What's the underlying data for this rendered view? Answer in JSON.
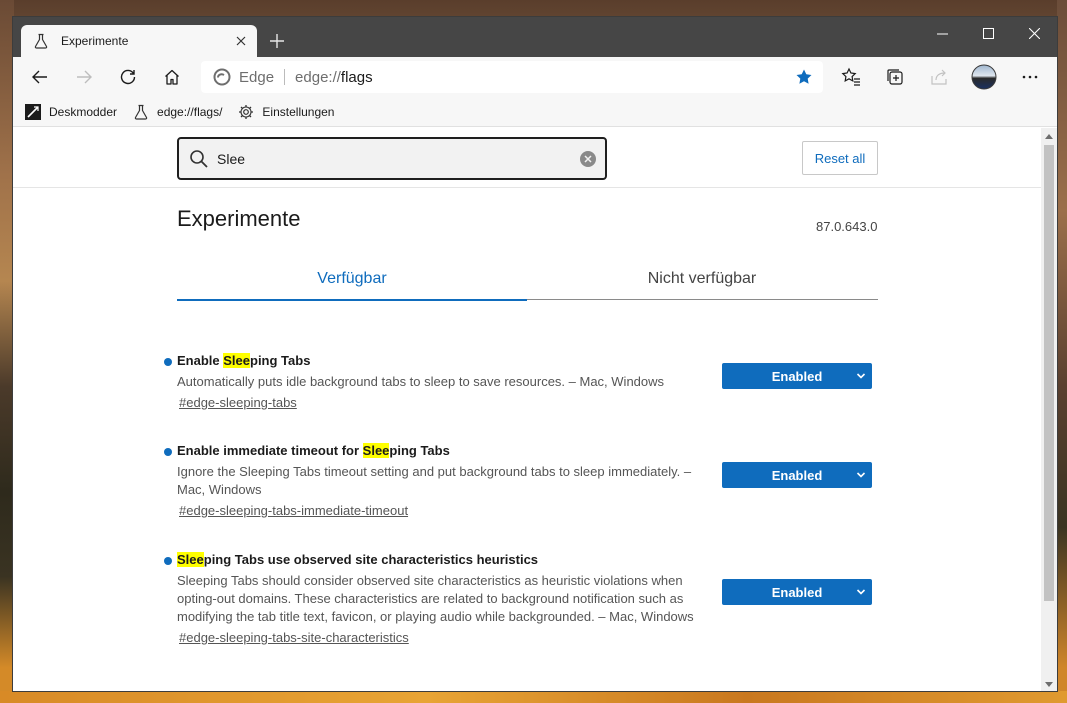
{
  "tab": {
    "title": "Experimente"
  },
  "omnibox": {
    "site_label": "Edge",
    "url_prefix": "edge://",
    "url_path": "flags"
  },
  "favorites": [
    {
      "label": "Deskmodder",
      "icon": "deskmodder-logo-icon"
    },
    {
      "label": "edge://flags/",
      "icon": "flask-icon"
    },
    {
      "label": "Einstellungen",
      "icon": "gear-icon"
    }
  ],
  "search": {
    "value": "Slee"
  },
  "reset_label": "Reset all",
  "page_title": "Experimente",
  "version": "87.0.643.0",
  "tabs": {
    "available": "Verfügbar",
    "unavailable": "Nicht verfügbar"
  },
  "experiments": [
    {
      "name_pre": "Enable ",
      "name_highlight": "Slee",
      "name_post": "ping Tabs",
      "description": "Automatically puts idle background tabs to sleep to save resources. – Mac, Windows",
      "link": "#edge-sleeping-tabs",
      "state": "Enabled"
    },
    {
      "name_pre": "Enable immediate timeout for ",
      "name_highlight": "Slee",
      "name_post": "ping Tabs",
      "description": "Ignore the Sleeping Tabs timeout setting and put background tabs to sleep immediately. – Mac, Windows",
      "link": "#edge-sleeping-tabs-immediate-timeout",
      "state": "Enabled"
    },
    {
      "name_pre": "",
      "name_highlight": "Slee",
      "name_post": "ping Tabs use observed site characteristics heuristics",
      "description": "Sleeping Tabs should consider observed site characteristics as heuristic violations when opting-out domains. These characteristics are related to background notification such as modifying the tab title text, favicon, or playing audio while backgrounded. – Mac, Windows",
      "link": "#edge-sleeping-tabs-site-characteristics",
      "state": "Enabled"
    }
  ],
  "colors": {
    "accent": "#0f6cbd",
    "highlight": "#ffff00",
    "titlebar": "#464646"
  }
}
